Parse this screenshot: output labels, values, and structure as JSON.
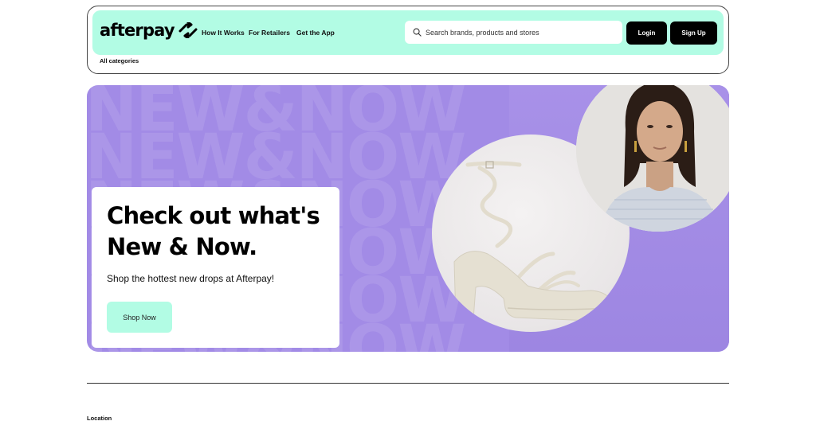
{
  "brand": {
    "logo_text": "afterpay"
  },
  "nav": {
    "items": [
      {
        "label": "How It Works"
      },
      {
        "label": "For Retailers"
      },
      {
        "label": "Get the App"
      }
    ]
  },
  "search": {
    "placeholder": "Search brands, products and stores",
    "value": ""
  },
  "auth": {
    "login_label": "Login",
    "signup_label": "Sign Up"
  },
  "categories": {
    "label": "All categories"
  },
  "hero": {
    "background_text": "NEW&NOW",
    "title": "Check out what's New & Now.",
    "subtitle": "Shop the hottest new drops at Afterpay!",
    "cta_label": "Shop Now"
  },
  "footer": {
    "location_label": "Location"
  },
  "colors": {
    "mint": "#b2fce4",
    "hero_purple": "#a28be6",
    "dark_button": "#000000"
  }
}
